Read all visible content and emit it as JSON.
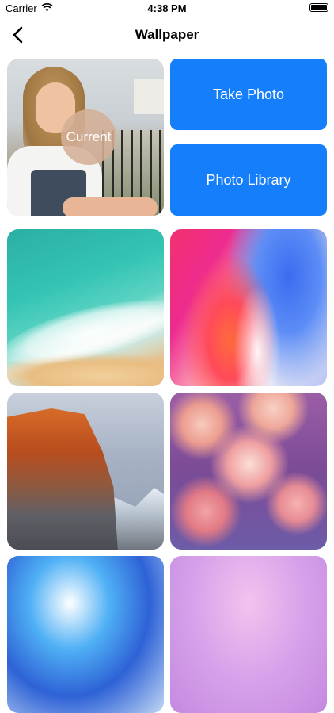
{
  "status_bar": {
    "carrier": "Carrier",
    "time": "4:38 PM"
  },
  "nav": {
    "title": "Wallpaper"
  },
  "current": {
    "badge": "Current"
  },
  "actions": {
    "take_photo": "Take Photo",
    "photo_library": "Photo Library"
  },
  "colors": {
    "accent": "#157efb",
    "divider": "#dcdcdc"
  },
  "wallpapers": [
    {
      "name": "ocean-shore"
    },
    {
      "name": "gradient-red-blue"
    },
    {
      "name": "mountain-cliff"
    },
    {
      "name": "pink-roses"
    },
    {
      "name": "blue-bubble"
    },
    {
      "name": "pink-purple-blur"
    }
  ]
}
